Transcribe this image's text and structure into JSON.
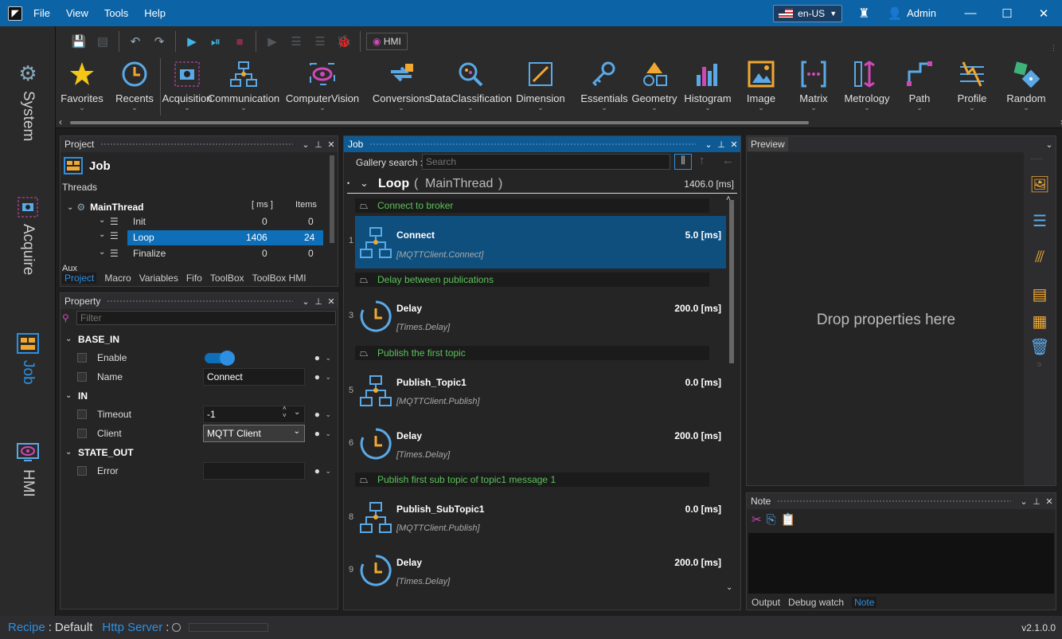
{
  "menu": [
    "File",
    "View",
    "Tools",
    "Help"
  ],
  "titlebar": {
    "language": "en-US",
    "user": "Admin"
  },
  "leftnav": [
    "System",
    "Acquire",
    "Job",
    "HMI"
  ],
  "quick_toolbar": {
    "hmi_label": "HMI"
  },
  "ribbon": [
    "Favorites",
    "Recents",
    "Acquisition",
    "Communication",
    "ComputerVision",
    "Conversions",
    "DataClassification",
    "Dimension",
    "Essentials",
    "Geometry",
    "Histogram",
    "Image",
    "Matrix",
    "Metrology",
    "Path",
    "Profile",
    "Random"
  ],
  "project": {
    "header": "Project",
    "title": "Job",
    "threads_label": "Threads",
    "col_ms": "[ ms ]",
    "col_items": "Items",
    "rows": [
      {
        "name": "MainThread",
        "ms": "",
        "items": ""
      },
      {
        "name": "Init",
        "ms": "0",
        "items": "0"
      },
      {
        "name": "Loop",
        "ms": "1406",
        "items": "24"
      },
      {
        "name": "Finalize",
        "ms": "0",
        "items": "0"
      }
    ],
    "aux_label": "Aux",
    "tabs": [
      "Project",
      "Macro",
      "Variables",
      "Fifo",
      "ToolBox",
      "ToolBox HMI"
    ]
  },
  "property": {
    "header": "Property",
    "filter_placeholder": "Filter",
    "sections": [
      "BASE_IN",
      "IN",
      "STATE_OUT"
    ],
    "rows": [
      {
        "name": "Enable",
        "value": ""
      },
      {
        "name": "Name",
        "value": "Connect"
      },
      {
        "name": "Timeout",
        "value": "-1"
      },
      {
        "name": "Client",
        "value": "MQTT Client"
      },
      {
        "name": "Error",
        "value": ""
      }
    ]
  },
  "job": {
    "header": "Job",
    "gallery_label": "Gallery search :",
    "search_placeholder": "Search",
    "loop_label": "Loop",
    "thread_label": "MainThread",
    "paren_open": "(",
    "paren_close": ")",
    "total_time": "1406.0 [ms]",
    "comments": [
      "Connect to broker",
      "Delay between publications",
      "Publish the first topic",
      "Publish first sub topic of topic1 message 1"
    ],
    "steps": [
      {
        "num": "1",
        "name": "Connect",
        "cls": "[MQTTClient.Connect]",
        "time": "5.0 [ms]"
      },
      {
        "num": "3",
        "name": "Delay",
        "cls": "[Times.Delay]",
        "time": "200.0 [ms]"
      },
      {
        "num": "5",
        "name": "Publish_Topic1",
        "cls": "[MQTTClient.Publish]",
        "time": "0.0 [ms]"
      },
      {
        "num": "6",
        "name": "Delay",
        "cls": "[Times.Delay]",
        "time": "200.0 [ms]"
      },
      {
        "num": "8",
        "name": "Publish_SubTopic1",
        "cls": "[MQTTClient.Publish]",
        "time": "0.0 [ms]"
      },
      {
        "num": "9",
        "name": "Delay",
        "cls": "[Times.Delay]",
        "time": "200.0 [ms]"
      }
    ]
  },
  "preview": {
    "header": "Preview",
    "drop_text": "Drop properties here"
  },
  "note": {
    "header": "Note",
    "tabs": [
      "Output",
      "Debug watch",
      "Note"
    ]
  },
  "status": {
    "recipe_label": "Recipe",
    "recipe_sep": ":",
    "recipe_value": "Default",
    "http_label": "Http Server",
    "http_sep": ":",
    "version": "v2.1.0.0"
  },
  "colors": {
    "accent": "#2e8fe0",
    "selection": "#0e5a94",
    "comment_text": "#5bc25b",
    "orange": "#f0a830"
  }
}
